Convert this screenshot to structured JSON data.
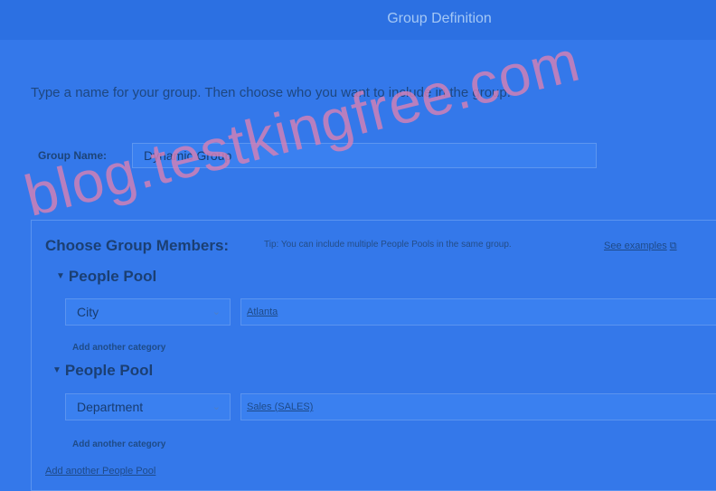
{
  "header": {
    "title": "Group Definition"
  },
  "intro_text": "Type a name for your group. Then choose who you want to include in the group.",
  "group_name": {
    "label": "Group Name:",
    "value": "Dynamic Group"
  },
  "members": {
    "heading": "Choose Group Members:",
    "tip": "Tip: You can include multiple People Pools in the same group.",
    "see_examples": "See examples",
    "pools": [
      {
        "title": "People Pool",
        "category": "City",
        "value": "Atlanta",
        "add_category": "Add another category"
      },
      {
        "title": "People Pool",
        "category": "Department",
        "value": "Sales (SALES)",
        "add_category": "Add another category"
      }
    ],
    "add_pool": "Add another People Pool"
  },
  "watermark": "blog.testkingfree.com",
  "icons": {
    "expand": "triangle-down-icon",
    "dropdown": "chevron-down-icon",
    "external": "external-link-icon"
  },
  "colors": {
    "background": "#3478ea",
    "text": "#16345e",
    "watermark": "#d680b4"
  }
}
